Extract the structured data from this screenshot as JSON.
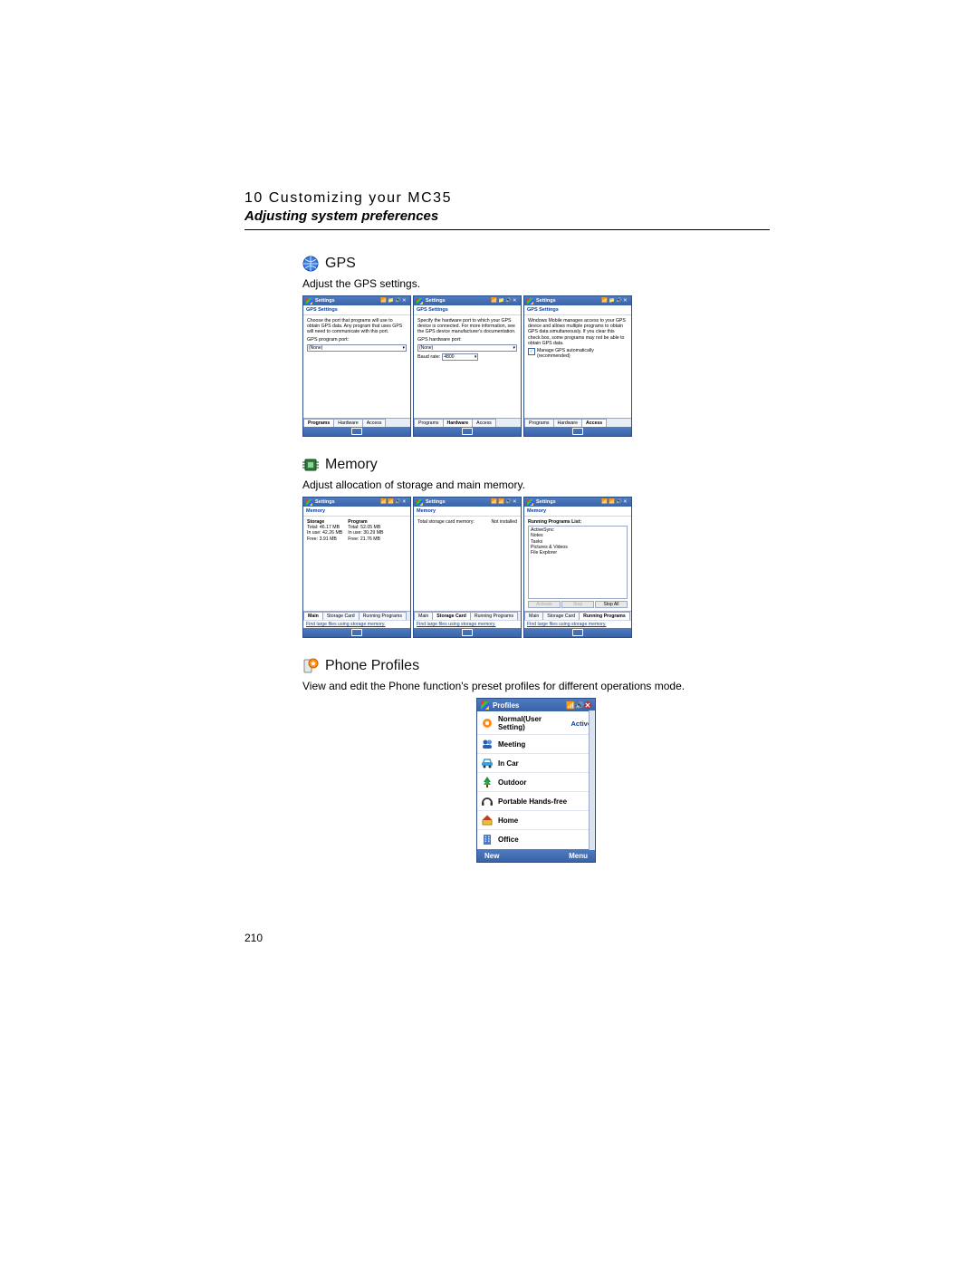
{
  "header": {
    "chapter": "10 Customizing your MC35",
    "subtitle": "Adjusting system preferences"
  },
  "page_number": "210",
  "gps": {
    "heading": "GPS",
    "desc": "Adjust the GPS settings.",
    "titlebar": "Settings",
    "subhead": "GPS Settings",
    "tabs": [
      "Programs",
      "Hardware",
      "Access"
    ],
    "shot1": {
      "hint": "Choose the port that programs will use to obtain GPS data. Any program that uses GPS will need to communicate with this port.",
      "label": "GPS program port:",
      "value": "(None)"
    },
    "shot2": {
      "hint": "Specify the hardware port to which your GPS device is connected. For more information, see the GPS device manufacturer's documentation.",
      "label_port": "GPS hardware port:",
      "value_port": "(None)",
      "label_baud": "Baud rate:",
      "value_baud": "4800"
    },
    "shot3": {
      "hint": "Windows Mobile manages access to your GPS device and allows multiple programs to obtain GPS data simultaneously. If you clear this check box, some programs may not be able to obtain GPS data.",
      "checkbox": "Manage GPS automatically (recommended)"
    }
  },
  "memory": {
    "heading": "Memory",
    "desc": "Adjust allocation of storage and main memory.",
    "titlebar": "Settings",
    "subhead": "Memory",
    "tabs": [
      "Main",
      "Storage Card",
      "Running Programs"
    ],
    "find_link_prefix": "Find",
    "find_link_rest": " large files using storage memory.",
    "shot1": {
      "storage_heading": "Storage",
      "program_heading": "Program",
      "rows": {
        "total_label": "Total:",
        "inuse_label": "In use:",
        "free_label": "Free:",
        "storage_total": "46.17 MB",
        "storage_inuse": "42.26 MB",
        "storage_free": "3.91 MB",
        "program_total": "52.05 MB",
        "program_inuse": "30.29 MB",
        "program_free": "21.76 MB"
      }
    },
    "shot2": {
      "label": "Total storage card memory:",
      "value": "Not installed"
    },
    "shot3": {
      "list_heading": "Running Programs List:",
      "programs": [
        "ActiveSync",
        "Notes",
        "Tasks",
        "Pictures & Videos",
        "File Explorer"
      ],
      "btn_activate": "Activate",
      "btn_stop": "Stop",
      "btn_stopall": "Stop All"
    }
  },
  "phone_profiles": {
    "heading": "Phone Profiles",
    "desc": "View and edit the Phone function's preset profiles for different operations mode.",
    "titlebar": "Profiles",
    "soft_left": "New",
    "soft_right": "Menu",
    "active_label": "Active",
    "items": [
      {
        "label": "Normal(User Setting)",
        "active": true
      },
      {
        "label": "Meeting"
      },
      {
        "label": "In Car"
      },
      {
        "label": "Outdoor"
      },
      {
        "label": "Portable Hands-free"
      },
      {
        "label": "Home"
      },
      {
        "label": "Office"
      }
    ]
  }
}
